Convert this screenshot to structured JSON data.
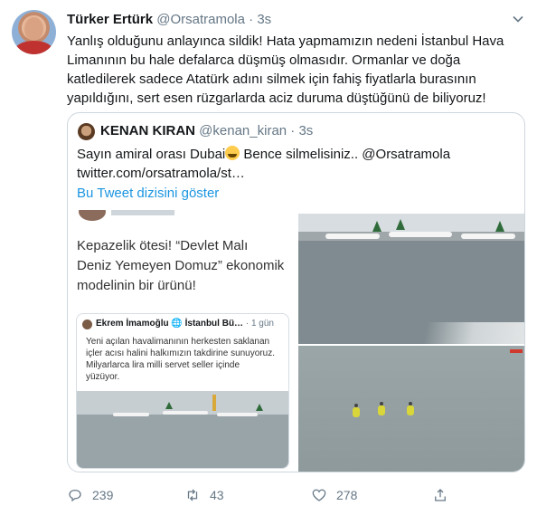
{
  "tweet": {
    "name": "Türker Ertürk",
    "handle": "@Orsatramola",
    "dot": "·",
    "time": "3s",
    "text": "Yanlış olduğunu anlayınca sildik! Hata yapmamızın nedeni İstanbul Hava Limanının bu hale defalarca düşmüş olmasıdır. Ormanlar ve doğa katledilerek sadece Atatürk adını silmek için fahiş fiyatlarla burasının yapıldığını, sert esen rüzgarlarda aciz duruma düştüğünü de biliyoruz!"
  },
  "quote": {
    "name": "KENAN KIRAN",
    "handle": "@kenan_kiran",
    "dot": "·",
    "time": "3s",
    "text_before_emoji": "Sayın amiral orası Dubai",
    "text_after_emoji": " Bence silmelisiniz.. @Orsatramola",
    "link": "twitter.com/orsatramola/st…",
    "thread_link": "Bu Tweet dizisini göster",
    "image_left": {
      "text": "Kepazelik ötesi! “Devlet Malı Deniz Yemeyen Domuz” ekonomik modelinin bir ürünü!",
      "inner": {
        "name": "Ekrem İmamoğlu",
        "globe": "🌐",
        "handle": "İstanbul Bü…",
        "time": "· 1 gün",
        "text": "Yeni açılan havalimanının herkesten saklanan içler acısı halini halkımızın takdirine sunuyoruz. Milyarlarca lira milli servet seller içinde yüzüyor."
      }
    }
  },
  "actions": {
    "reply_count": "239",
    "retweet_count": "43",
    "like_count": "278"
  },
  "icons": [
    "chevron-down-icon",
    "reply-icon",
    "retweet-icon",
    "like-icon",
    "share-icon"
  ],
  "colors": {
    "link": "#1b95e0",
    "muted": "#657786",
    "border": "#ccd6dd"
  }
}
